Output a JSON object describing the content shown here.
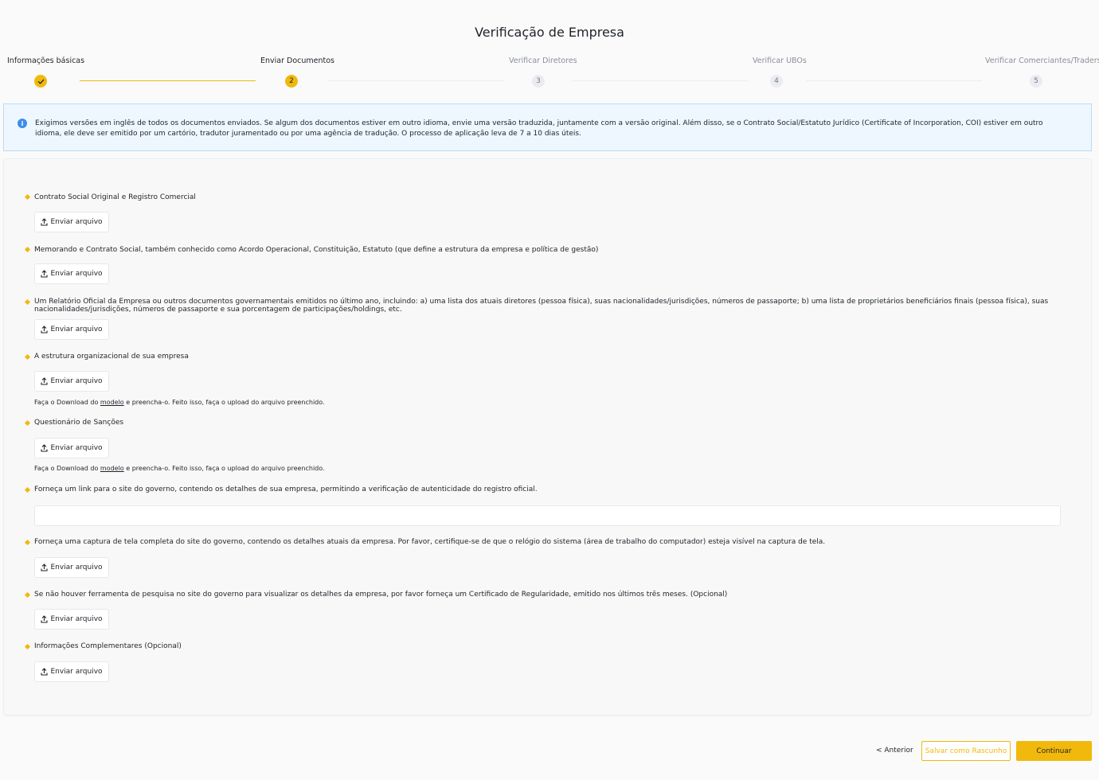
{
  "page": {
    "title": "Verificação de Empresa"
  },
  "stepper": [
    {
      "label": "Informações básicas",
      "number": "",
      "state": "done"
    },
    {
      "label": "Enviar Documentos",
      "number": "2",
      "state": "active"
    },
    {
      "label": "Verificar Diretores",
      "number": "3",
      "state": "pending"
    },
    {
      "label": "Verificar UBOs",
      "number": "4",
      "state": "pending"
    },
    {
      "label": "Verificar Comerciantes/Traders",
      "number": "5",
      "state": "pending"
    }
  ],
  "info": {
    "text": "Exigimos versões em inglês de todos os documentos enviados. Se algum dos documentos estiver em outro idioma, envie uma versão traduzida, juntamente com a versão original. Além disso, se o Contrato Social/Estatuto Jurídico (Certificate of Incorporation, COI) estiver em outro idioma, ele deve ser emitido por um cartório, tradutor juramentado ou por uma agência de tradução. O processo de aplicação leva de 7 a 10 dias úteis."
  },
  "upload_label": "Enviar arquivo",
  "template_note": {
    "before": "Faça o Download do",
    "link": "modelo",
    "after": "e preencha-o. Feito isso, faça o upload do arquivo preenchido."
  },
  "requirements": [
    {
      "label": "Contrato Social Original e Registro Comercial"
    },
    {
      "label": "Memorando e Contrato Social, também conhecido como Acordo Operacional, Constituição, Estatuto (que define a estrutura da empresa e política de gestão)"
    },
    {
      "label": "Um Relatório Oficial da Empresa ou outros documentos governamentais emitidos no último ano, incluindo: a) uma lista dos atuais diretores (pessoa física), suas nacionalidades/jurisdições, números de passaporte; b) uma lista de proprietários beneficiários finais (pessoa física), suas nacionalidades/jurisdições, números de passaporte e sua porcentagem de participações/holdings, etc."
    },
    {
      "label": "A estrutura organizacional de sua empresa"
    },
    {
      "label": "Questionário de Sanções"
    },
    {
      "label": "Forneça um link para o site do governo, contendo os detalhes de sua empresa, permitindo a verificação de autenticidade do registro oficial."
    },
    {
      "label": "Forneça uma captura de tela completa do site do governo, contendo os detalhes atuais da empresa. Por favor, certifique-se de que o relógio do sistema (área de trabalho do computador) esteja visível na captura de tela."
    },
    {
      "label": "Se não houver ferramenta de pesquisa no site do governo para visualizar os detalhes da empresa, por favor forneça um Certificado de Regularidade, emitido nos últimos três meses. (Opcional)"
    },
    {
      "label": "Informações Complementares (Opcional)"
    }
  ],
  "link_input": {
    "value": "",
    "placeholder": ""
  },
  "footer": {
    "prev": "< Anterior",
    "draft": "Salvar como Rascunho",
    "continue": "Continuar"
  },
  "colors": {
    "accent": "#f0b90b",
    "info_bg": "#eef7ff",
    "info_border": "#b7dcf9",
    "info_icon": "#3d8ee6"
  }
}
